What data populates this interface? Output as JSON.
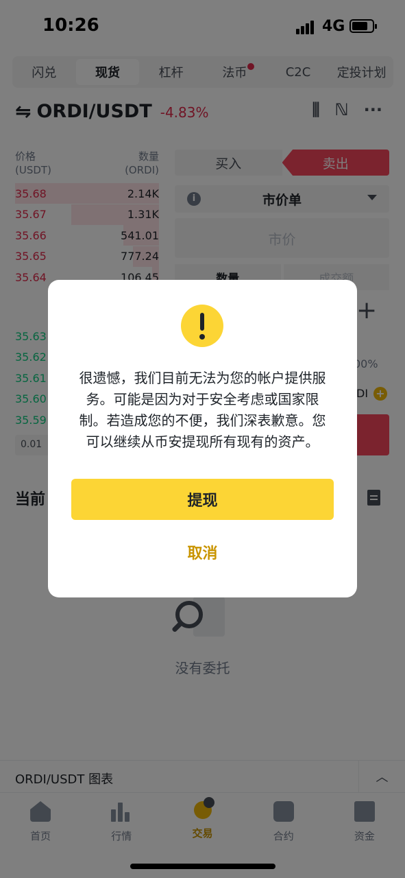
{
  "status_bar": {
    "time": "10:26",
    "network": "4G"
  },
  "top_tabs": [
    {
      "label": "闪兑"
    },
    {
      "label": "现货"
    },
    {
      "label": "杠杆"
    },
    {
      "label": "法币"
    },
    {
      "label": "C2C"
    },
    {
      "label": "定投计划"
    }
  ],
  "pair": {
    "name": "ORDI/USDT",
    "change": "-4.83%"
  },
  "order_book": {
    "price_label": "价格",
    "price_unit": "(USDT)",
    "qty_label": "数量",
    "qty_unit": "(ORDI)",
    "asks": [
      {
        "price": "35.68",
        "qty": "2.14K",
        "depth": 1.0
      },
      {
        "price": "35.67",
        "qty": "1.31K",
        "depth": 0.61
      },
      {
        "price": "35.66",
        "qty": "541.01",
        "depth": 0.25
      },
      {
        "price": "35.65",
        "qty": "777.24",
        "depth": 0.18
      },
      {
        "price": "35.64",
        "qty": "106.45",
        "depth": 0.05
      }
    ],
    "bids": [
      {
        "price": "35.63"
      },
      {
        "price": "35.62"
      },
      {
        "price": "35.61"
      },
      {
        "price": "35.60"
      },
      {
        "price": "35.59"
      }
    ],
    "depth_step": "0.01"
  },
  "trade_form": {
    "buy_label": "买入",
    "sell_label": "卖出",
    "order_type": "市价单",
    "price_placeholder": "市价",
    "amount_tab": "数量",
    "total_tab": "成交额",
    "percent_text": "00%",
    "asset_text": "DI"
  },
  "current_orders": {
    "title": "当前",
    "empty_text": "没有委托"
  },
  "chart_bar": {
    "label": "ORDI/USDT 图表"
  },
  "bottom_nav": [
    {
      "label": "首页",
      "icon": "home-icon"
    },
    {
      "label": "行情",
      "icon": "markets-icon"
    },
    {
      "label": "交易",
      "icon": "trade-icon"
    },
    {
      "label": "合约",
      "icon": "futures-icon"
    },
    {
      "label": "资金",
      "icon": "wallet-icon"
    }
  ],
  "dialog": {
    "message": "很遗憾，我们目前无法为您的帐户提供服务。可能是因为对于安全考虑或国家限制。若造成您的不便，我们深表歉意。您可以继续从币安提现所有现有的资产。",
    "primary_button": "提现",
    "secondary_button": "取消"
  },
  "colors": {
    "accent": "#fcd535",
    "accent_text": "#c99400",
    "sell_red": "#f6465d",
    "buy_green": "#0ecb81"
  }
}
